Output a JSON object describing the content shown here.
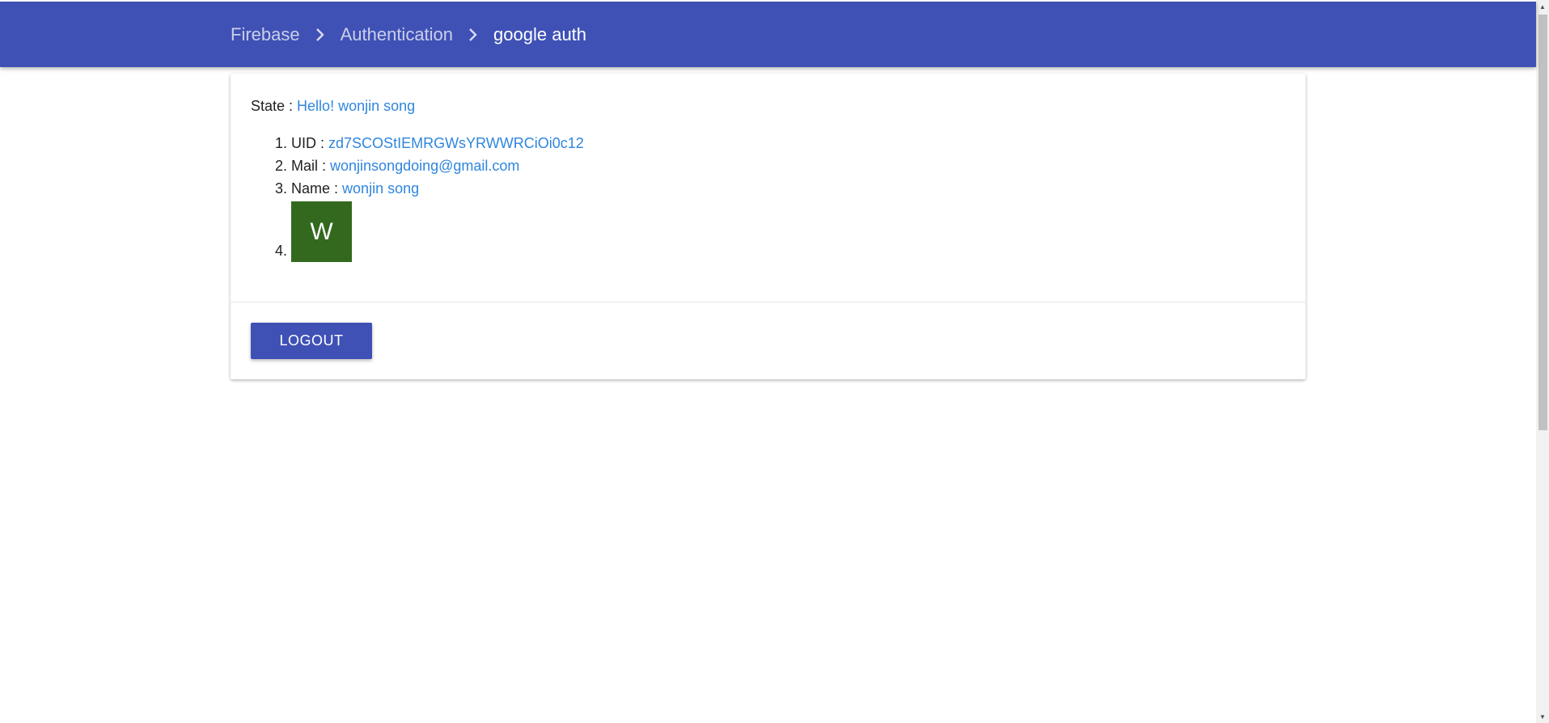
{
  "breadcrumb": {
    "items": [
      {
        "label": "Firebase"
      },
      {
        "label": "Authentication"
      },
      {
        "label": "google auth"
      }
    ],
    "separator_icon": "chevron-right-icon"
  },
  "card": {
    "state_label": "State :",
    "state_value": "Hello! wonjin song",
    "info": [
      {
        "num": "1.",
        "label": "UID :",
        "value": "zd7SCOStIEMRGWsYRWWRCiOi0c12"
      },
      {
        "num": "2.",
        "label": "Mail :",
        "value": "wonjinsongdoing@gmail.com"
      },
      {
        "num": "3.",
        "label": "Name :",
        "value": "wonjin song"
      }
    ],
    "avatar": {
      "num": "4.",
      "letter": "W",
      "color": "#33691e"
    },
    "logout_label": "LOGOUT"
  },
  "colors": {
    "primary": "#3f51b5",
    "link": "#2f86de"
  }
}
